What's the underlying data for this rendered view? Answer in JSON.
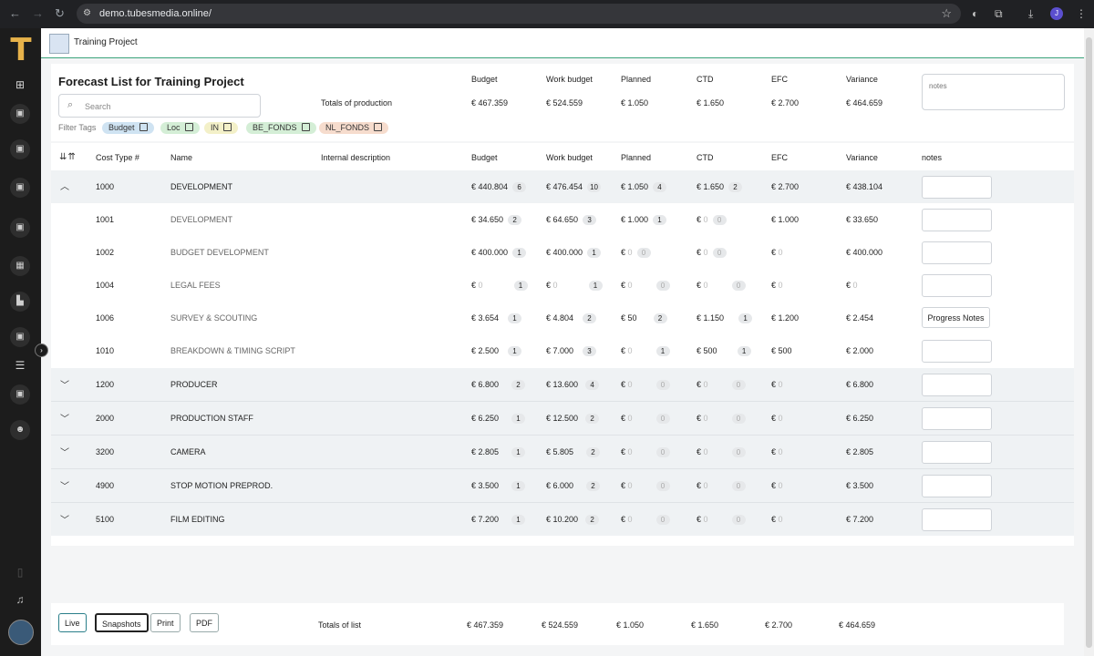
{
  "browser": {
    "url": "demo.tubesmedia.online/",
    "profile_initial": "J"
  },
  "app": {
    "project_title": "Training Project"
  },
  "header": {
    "page_title": "Forecast List for Training Project",
    "search_placeholder": "Search",
    "filter_label": "Filter Tags",
    "tags": [
      {
        "label": "Budget",
        "color": "#cfe3f2"
      },
      {
        "label": "Loc",
        "color": "#d4eed6"
      },
      {
        "label": "IN",
        "color": "#f3f0c8"
      },
      {
        "label": "BE_FONDS",
        "color": "#d4eed6"
      },
      {
        "label": "NL_FONDS",
        "color": "#f6dccd"
      }
    ],
    "totals_label": "Totals of production",
    "columns": [
      "Budget",
      "Work budget",
      "Planned",
      "CTD",
      "EFC",
      "Variance"
    ],
    "totals": [
      "€ 467.359",
      "€ 524.559",
      "€ 1.050",
      "€ 1.650",
      "€ 2.700",
      "€ 464.659"
    ],
    "notes_placeholder": "notes"
  },
  "table": {
    "headers": {
      "cost_type": "Cost Type #",
      "name": "Name",
      "internal_description": "Internal description",
      "budget": "Budget",
      "work_budget": "Work budget",
      "planned": "Planned",
      "ctd": "CTD",
      "efc": "EFC",
      "variance": "Variance",
      "notes": "notes"
    },
    "groups": [
      {
        "code": "1000",
        "name": "DEVELOPMENT",
        "expanded": true,
        "budget": "€ 440.804",
        "budget_count": "6",
        "work_budget": "€ 476.454",
        "work_budget_count": "10",
        "planned": "€ 1.050",
        "planned_count": "4",
        "ctd": "€ 1.650",
        "ctd_count": "2",
        "efc": "€ 2.700",
        "variance": "€ 438.104",
        "children": [
          {
            "code": "1001",
            "name": "DEVELOPMENT",
            "budget": "€ 34.650",
            "budget_count": "2",
            "work_budget": "€ 64.650",
            "work_budget_count": "3",
            "planned": "€ 1.000",
            "planned_count": "1",
            "ctd_cur": "€",
            "ctd_amt": "0",
            "ctd_count": "0",
            "efc_cur": "€",
            "efc_amt": "1.000",
            "variance_cur": "€",
            "variance_amt": "33.650"
          },
          {
            "code": "1002",
            "name": "BUDGET DEVELOPMENT",
            "budget": "€ 400.000",
            "budget_count": "1",
            "work_budget": "€ 400.000",
            "work_budget_count": "1",
            "planned": "€ 0",
            "planned_count": "0",
            "ctd_cur": "€",
            "ctd_amt": "0",
            "ctd_count": "0",
            "efc_cur": "€",
            "efc_amt": "0",
            "variance_cur": "€",
            "variance_amt": "400.000"
          },
          {
            "code": "1004",
            "name": "LEGAL FEES",
            "budget": "€ 0",
            "budget_count": "1",
            "work_budget": "€ 0",
            "work_budget_count": "1",
            "planned": "€ 0",
            "planned_count": "0",
            "ctd_cur": "€",
            "ctd_amt": "0",
            "ctd_count": "0",
            "efc_cur": "€",
            "efc_amt": "0",
            "variance_cur": "€",
            "variance_amt": "0"
          },
          {
            "code": "1006",
            "name": "SURVEY & SCOUTING",
            "budget": "€ 3.654",
            "budget_count": "1",
            "work_budget": "€ 4.804",
            "work_budget_count": "2",
            "planned": "€ 50",
            "planned_count": "2",
            "ctd_cur": "€",
            "ctd_amt": "1.150",
            "ctd_count": "1",
            "efc_cur": "€",
            "efc_amt": "1.200",
            "variance_cur": "€",
            "variance_amt": "2.454",
            "notes_button": "Progress Notes"
          },
          {
            "code": "1010",
            "name": "BREAKDOWN & TIMING SCRIPT",
            "budget": "€ 2.500",
            "budget_count": "1",
            "work_budget": "€ 7.000",
            "work_budget_count": "3",
            "planned": "€ 0",
            "planned_count": "1",
            "ctd_cur": "€",
            "ctd_amt": "500",
            "ctd_count": "1",
            "efc_cur": "€",
            "efc_amt": "500",
            "variance_cur": "€",
            "variance_amt": "2.000"
          }
        ]
      },
      {
        "code": "1200",
        "name": "PRODUCER",
        "budget": "€ 6.800",
        "budget_count": "2",
        "work_budget": "€ 13.600",
        "work_budget_count": "4",
        "planned": "€ 0",
        "planned_count": "0",
        "ctd": "€ 0",
        "ctd_count": "0",
        "efc": "€ 0",
        "variance": "€ 6.800"
      },
      {
        "code": "2000",
        "name": "PRODUCTION STAFF",
        "budget": "€ 6.250",
        "budget_count": "1",
        "work_budget": "€ 12.500",
        "work_budget_count": "2",
        "planned": "€ 0",
        "planned_count": "0",
        "ctd": "€ 0",
        "ctd_count": "0",
        "efc": "€ 0",
        "variance": "€ 6.250"
      },
      {
        "code": "3200",
        "name": "CAMERA",
        "budget": "€ 2.805",
        "budget_count": "1",
        "work_budget": "€ 5.805",
        "work_budget_count": "2",
        "planned": "€ 0",
        "planned_count": "0",
        "ctd": "€ 0",
        "ctd_count": "0",
        "efc": "€ 0",
        "variance": "€ 2.805"
      },
      {
        "code": "4900",
        "name": "STOP MOTION PREPROD.",
        "budget": "€ 3.500",
        "budget_count": "1",
        "work_budget": "€ 6.000",
        "work_budget_count": "2",
        "planned": "€ 0",
        "planned_count": "0",
        "ctd": "€ 0",
        "ctd_count": "0",
        "efc": "€ 0",
        "variance": "€ 3.500"
      },
      {
        "code": "5100",
        "name": "FILM EDITING",
        "budget": "€ 7.200",
        "budget_count": "1",
        "work_budget": "€ 10.200",
        "work_budget_count": "2",
        "planned": "€ 0",
        "planned_count": "0",
        "ctd": "€ 0",
        "ctd_count": "0",
        "efc": "€ 0",
        "variance": "€ 7.200"
      }
    ]
  },
  "footer": {
    "buttons": {
      "live": "Live",
      "snapshots": "Snapshots",
      "print": "Print",
      "pdf": "PDF"
    },
    "totals_label": "Totals of list",
    "totals": [
      "€ 467.359",
      "€ 524.559",
      "€ 1.050",
      "€ 1.650",
      "€ 2.700",
      "€ 464.659"
    ]
  },
  "icons": {
    "sidebar": [
      "apps-icon",
      "film-icon",
      "film-icon",
      "film-icon",
      "film-icon",
      "calendar-icon",
      "report-icon",
      "film-icon",
      "list-icon",
      "film-icon",
      "team-icon",
      "book-icon",
      "bell-icon"
    ]
  }
}
